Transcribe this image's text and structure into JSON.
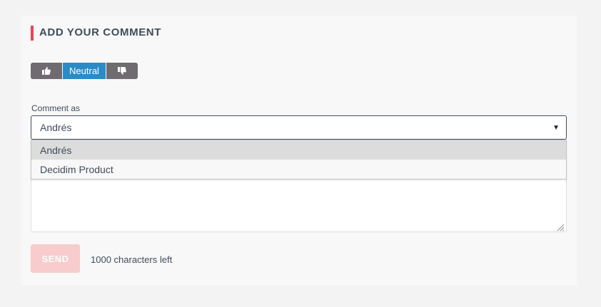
{
  "comment_form": {
    "title": "ADD YOUR COMMENT",
    "alignment": {
      "in_favor_icon": "thumbs-up-icon",
      "neutral_label": "Neutral",
      "against_icon": "thumbs-down-icon",
      "selected": "Neutral"
    },
    "comment_as": {
      "label": "Comment as",
      "selected_value": "Andrés",
      "options": [
        "Andrés",
        "Decidim Product"
      ]
    },
    "send_label": "SEND",
    "characters_left": "1000 characters left"
  },
  "colors": {
    "accent": "#ef4155",
    "neutral_active": "#2b8bc7",
    "alignment_button": "#6f6b70",
    "send_disabled": "#f8cbcc"
  }
}
